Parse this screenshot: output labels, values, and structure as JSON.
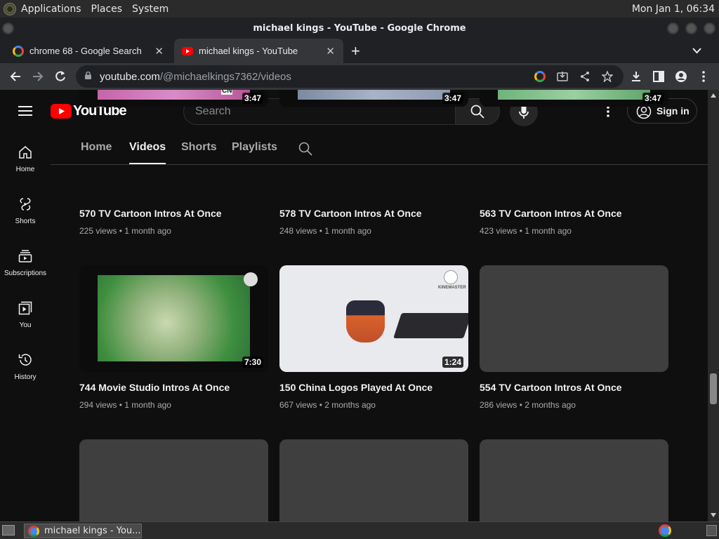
{
  "panel": {
    "applications": "Applications",
    "places": "Places",
    "system": "System",
    "clock": "Mon Jan 1, 06:34"
  },
  "window": {
    "title": "michael kings - YouTube - Google Chrome"
  },
  "tabs": [
    {
      "label": "chrome 68 - Google Search",
      "active": false
    },
    {
      "label": "michael kings - YouTube",
      "active": true
    }
  ],
  "omnibox": {
    "host": "youtube.com",
    "path": "/@michaelkings7362/videos"
  },
  "youtube": {
    "logo_text": "YouTube",
    "search_placeholder": "Search",
    "sign_in": "Sign in",
    "channel_tabs": [
      "Home",
      "Videos",
      "Shorts",
      "Playlists"
    ],
    "sidebar": [
      {
        "label": "Home",
        "icon": "home-icon"
      },
      {
        "label": "Shorts",
        "icon": "shorts-icon"
      },
      {
        "label": "Subscriptions",
        "icon": "subscriptions-icon"
      },
      {
        "label": "You",
        "icon": "you-icon"
      },
      {
        "label": "History",
        "icon": "history-icon"
      }
    ],
    "videos": [
      {
        "title": "570 TV Cartoon Intros At Once",
        "views": "225 views",
        "age": "1 month ago",
        "duration": "3:47"
      },
      {
        "title": "578 TV Cartoon Intros At Once",
        "views": "248 views",
        "age": "1 month ago",
        "duration": "3:47"
      },
      {
        "title": "563 TV Cartoon Intros At Once",
        "views": "423 views",
        "age": "1 month ago",
        "duration": "3:47"
      },
      {
        "title": "744 Movie Studio Intros At Once",
        "views": "294 views",
        "age": "1 month ago",
        "duration": "7:30"
      },
      {
        "title": "150 China Logos Played At Once",
        "views": "667 views",
        "age": "2 months ago",
        "duration": "1:24"
      },
      {
        "title": "554 TV Cartoon Intros At Once",
        "views": "286 views",
        "age": "2 months ago",
        "duration": ""
      }
    ],
    "thumb_texts": {
      "cn_logo": "CN",
      "kinemaster": "KINEMASTER"
    }
  },
  "taskbar": {
    "item": "michael kings - You..."
  },
  "colors": {
    "yt_red": "#ff0000",
    "bg": "#0f0f0f",
    "chrome_frame": "#202124"
  }
}
